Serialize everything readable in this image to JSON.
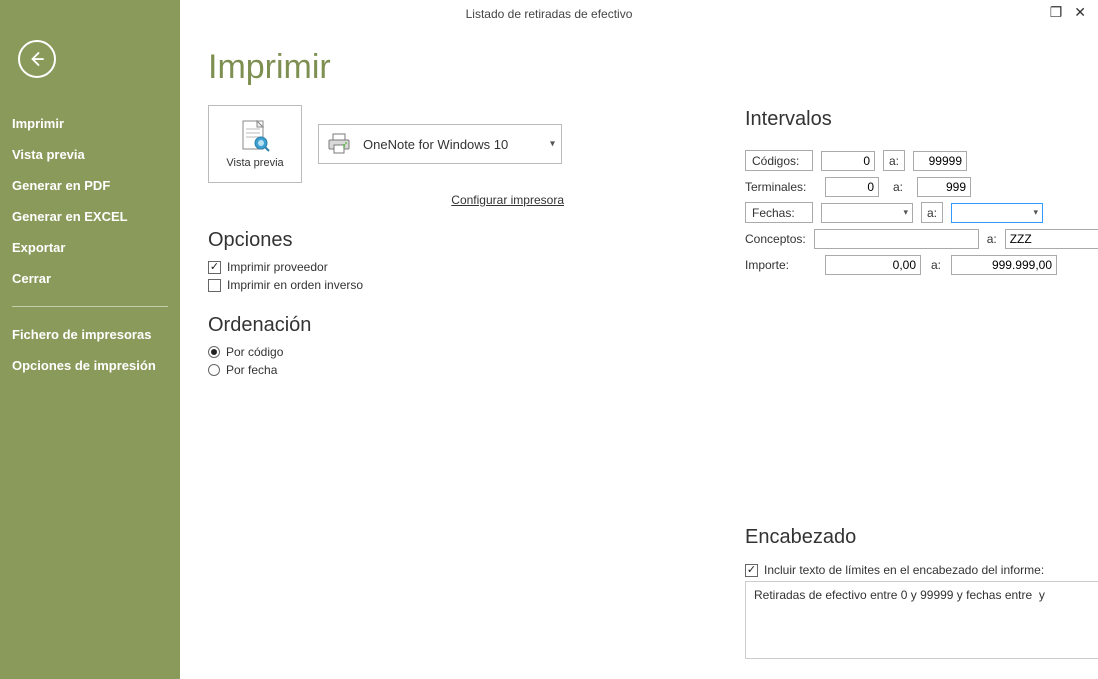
{
  "window": {
    "title": "Listado de retiradas de efectivo"
  },
  "sidebar": {
    "items": [
      {
        "label": "Imprimir"
      },
      {
        "label": "Vista previa"
      },
      {
        "label": "Generar en PDF"
      },
      {
        "label": "Generar en EXCEL"
      },
      {
        "label": "Exportar"
      },
      {
        "label": "Cerrar"
      }
    ],
    "secondary": [
      {
        "label": "Fichero de impresoras"
      },
      {
        "label": "Opciones de impresión"
      }
    ]
  },
  "page": {
    "title": "Imprimir"
  },
  "preview": {
    "label": "Vista previa"
  },
  "printer": {
    "selected": "OneNote for Windows 10"
  },
  "links": {
    "config_printer": "Configurar impresora"
  },
  "options": {
    "heading": "Opciones",
    "print_provider": "Imprimir proveedor",
    "print_reverse": "Imprimir en orden inverso"
  },
  "ordering": {
    "heading": "Ordenación",
    "by_code": "Por código",
    "by_date": "Por fecha"
  },
  "intervals": {
    "heading": "Intervalos",
    "codes_label": "Códigos:",
    "codes_from": "0",
    "codes_to": "99999",
    "terminals_label": "Terminales:",
    "terminals_from": "0",
    "terminals_to": "999",
    "dates_label": "Fechas:",
    "dates_from": "",
    "dates_to": "",
    "concepts_label": "Conceptos:",
    "concepts_from": "",
    "concepts_to": "ZZZ",
    "amount_label": "Importe:",
    "amount_from": "0,00",
    "amount_to": "999.999,00",
    "a_label": "a:"
  },
  "header": {
    "heading": "Encabezado",
    "include_limits": "Incluir texto de límites en el encabezado del informe:",
    "report_text": "Retiradas de efectivo entre 0 y 99999 y fechas entre  y"
  }
}
